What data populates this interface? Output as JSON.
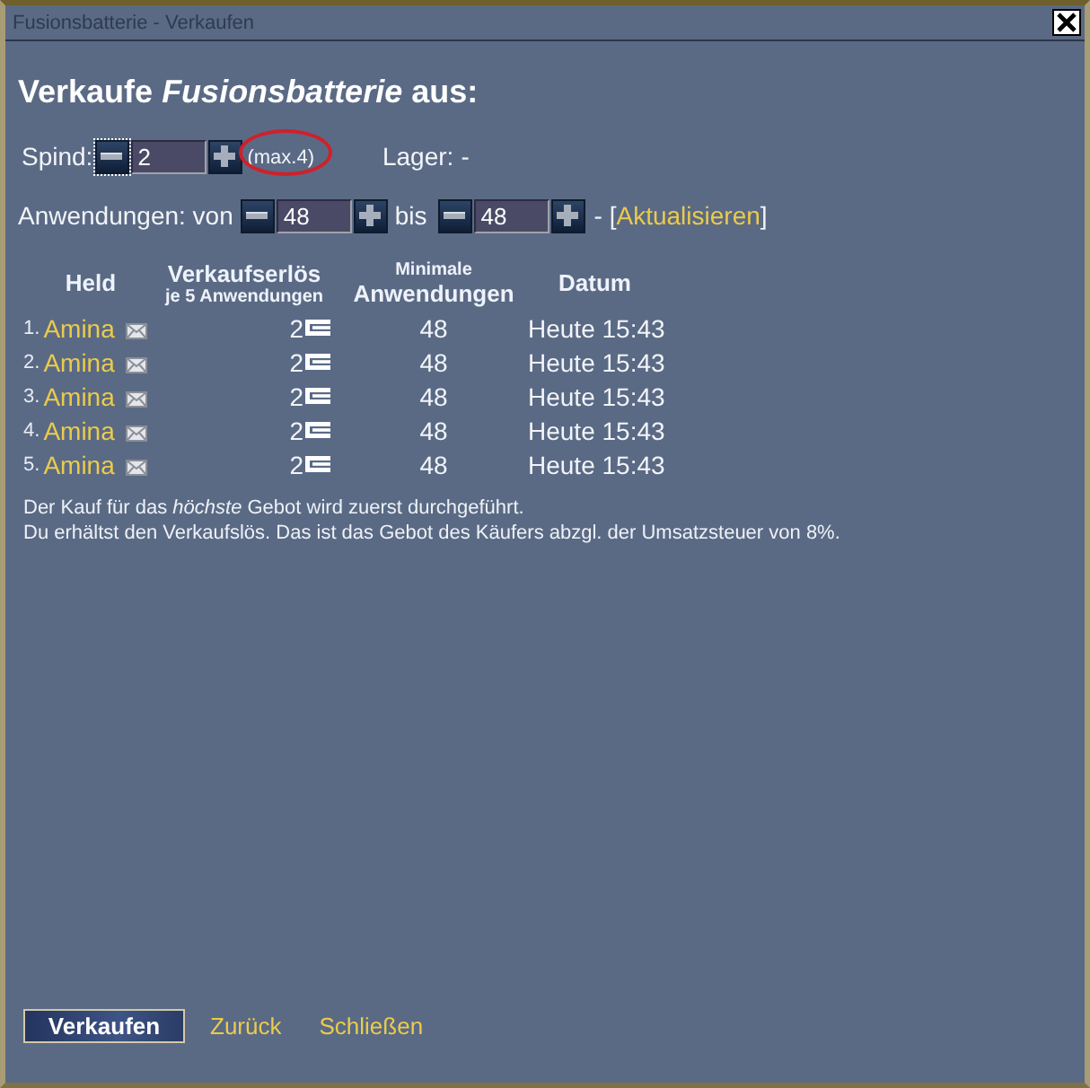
{
  "window": {
    "title": "Fusionsbatterie - Verkaufen"
  },
  "heading": "Verkaufe *Fusionsbatterie* aus:",
  "spind": {
    "label": "Spind:",
    "value": "2",
    "decrease_focused": true,
    "max": "(max.4)",
    "max_highlighted": true
  },
  "lager": {
    "label": "Lager:",
    "value": "-"
  },
  "uses": {
    "label": "Anwendungen: von",
    "from": "48",
    "to_label": "bis",
    "to": "48",
    "separator": "- [",
    "refresh": "Aktualisieren",
    "close_bracket": "]"
  },
  "table": {
    "columns": [
      {
        "title": "Held"
      },
      {
        "title": "Verkaufserlös",
        "subtitle": "je 5 Anwendungen"
      },
      {
        "pretitle": "Minimale",
        "title": "Anwendungen"
      },
      {
        "title": "Datum"
      }
    ],
    "rows": [
      {
        "rank": "1.",
        "hero": "Amina",
        "price": "2",
        "min_uses": "48",
        "date": "Heute 15:43"
      },
      {
        "rank": "2.",
        "hero": "Amina",
        "price": "2",
        "min_uses": "48",
        "date": "Heute 15:43"
      },
      {
        "rank": "3.",
        "hero": "Amina",
        "price": "2",
        "min_uses": "48",
        "date": "Heute 15:43"
      },
      {
        "rank": "4.",
        "hero": "Amina",
        "price": "2",
        "min_uses": "48",
        "date": "Heute 15:43"
      },
      {
        "rank": "5.",
        "hero": "Amina",
        "price": "2",
        "min_uses": "48",
        "date": "Heute 15:43"
      }
    ]
  },
  "notes": [
    "Der Kauf für das *höchste* Gebot wird zuerst durchgeführt.",
    "Du erhältst den Verkaufslös. Das ist das Gebot des Käufers abzgl. der Umsatzsteuer von 8%."
  ],
  "footer": {
    "buttons": [
      {
        "label": "Verkaufen",
        "kind": "button"
      },
      {
        "label": "Zurück",
        "kind": "link"
      },
      {
        "label": "Schließen",
        "kind": "link"
      }
    ]
  }
}
